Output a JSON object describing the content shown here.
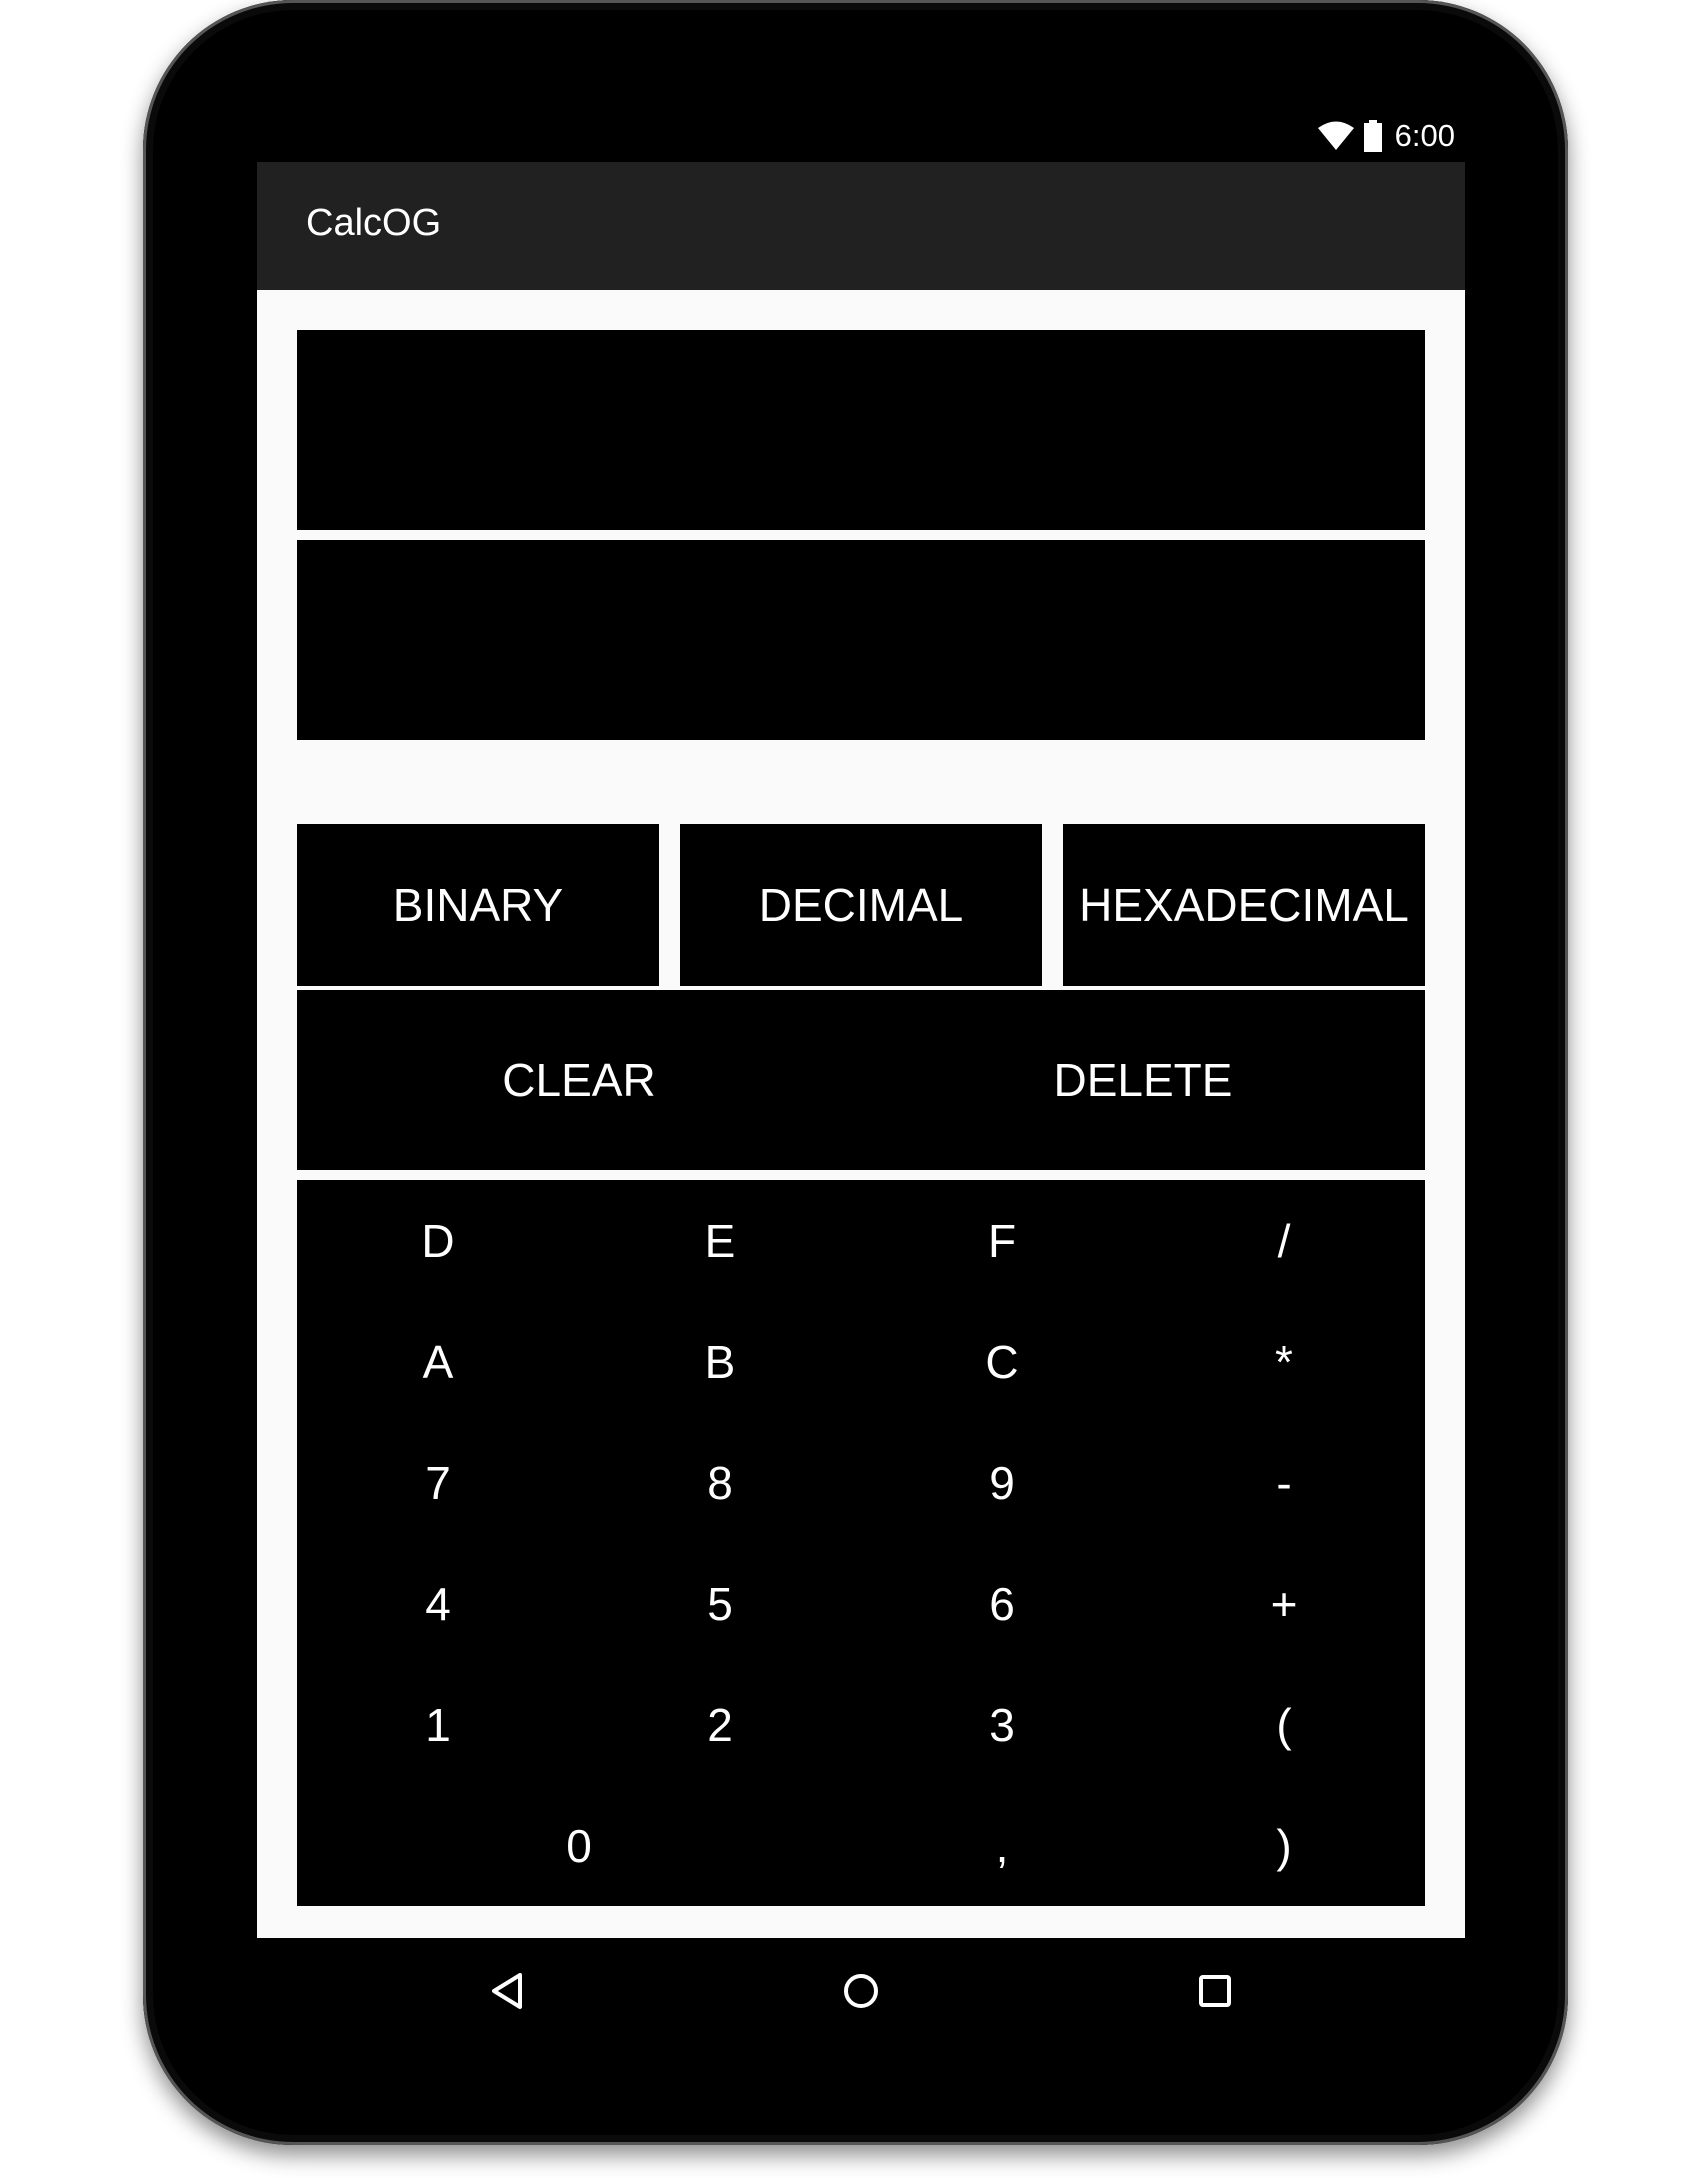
{
  "status_bar": {
    "time": "6:00",
    "icons": [
      "wifi-icon",
      "battery-icon"
    ]
  },
  "app_bar": {
    "title": "CalcOG"
  },
  "display": {
    "expression": "",
    "result": ""
  },
  "modes": {
    "binary": "BINARY",
    "decimal": "DECIMAL",
    "hexadecimal": "HEXADECIMAL"
  },
  "actions": {
    "clear": "CLEAR",
    "delete": "DELETE"
  },
  "keypad": {
    "rows": [
      [
        "D",
        "E",
        "F",
        "/"
      ],
      [
        "A",
        "B",
        "C",
        "*"
      ],
      [
        "7",
        "8",
        "9",
        "-"
      ],
      [
        "4",
        "5",
        "6",
        "+"
      ],
      [
        "1",
        "2",
        "3",
        "("
      ],
      [
        "0",
        ",",
        ")"
      ]
    ]
  },
  "nav_bar": {
    "icons": [
      "back-icon",
      "home-icon",
      "recents-icon"
    ]
  },
  "colors": {
    "app_bar": "#212121",
    "content_background": "#fafafa",
    "button_background": "#000000",
    "text": "#ffffff"
  }
}
